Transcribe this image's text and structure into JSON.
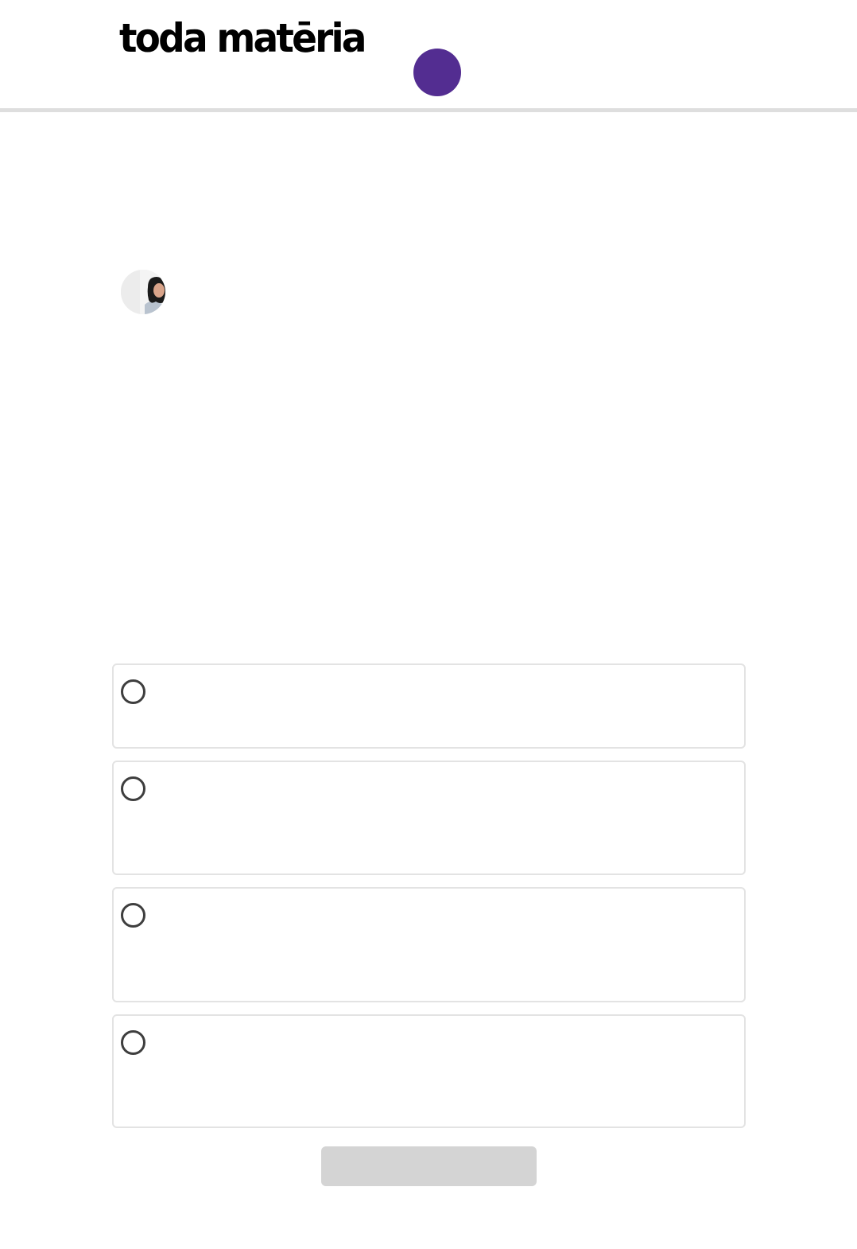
{
  "header": {
    "logo_text": "toda matēria",
    "circle_color": "#532d91"
  },
  "author": {
    "avatar": "author-avatar"
  },
  "quiz": {
    "options": [
      {
        "text": ""
      },
      {
        "text": ""
      },
      {
        "text": ""
      },
      {
        "text": ""
      }
    ],
    "submit_label": "",
    "submit_color": "#d4d4d4"
  },
  "colors": {
    "accent": "#532d91",
    "border": "#e3e3e3",
    "divider": "#dedede",
    "radio": "#3e3e3e",
    "button_disabled": "#d4d4d4"
  }
}
